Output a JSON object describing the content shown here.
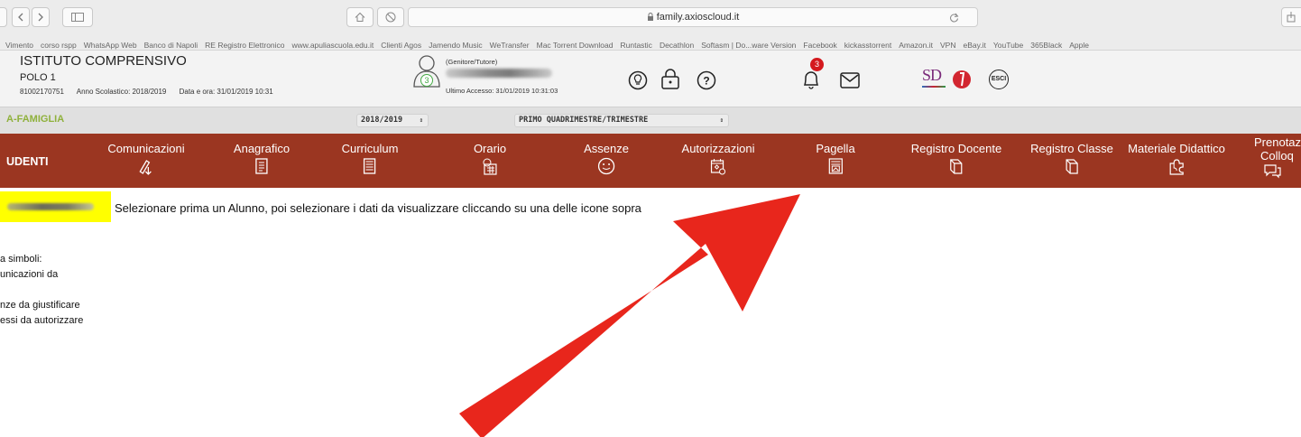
{
  "browser": {
    "url": "family.axioscloud.it"
  },
  "bookmarks": [
    "Vimento",
    "corso rspp",
    "WhatsApp Web",
    "Banco di Napoli",
    "RE Registro Elettronico",
    "www.apuliascuola.edu.it",
    "Clienti Agos",
    "Jamendo Music",
    "WeTransfer",
    "Mac Torrent Download",
    "Runtastic",
    "Decathlon",
    "Softasm | Do...ware Version",
    "Facebook",
    "kickasstorrent",
    "Amazon.it",
    "VPN",
    "eBay.it",
    "YouTube",
    "365Black",
    "Apple"
  ],
  "school": {
    "name": "ISTITUTO COMPRENSIVO",
    "polo": "POLO 1",
    "code": "81002170751",
    "year": "Anno Scolastico: 2018/2019",
    "datetime": "Data e ora: 31/01/2019 10:31"
  },
  "user": {
    "role": "(Genitore/Tutore)",
    "last_access": "Ultimo Accesso: 31/01/2019 10:31:03",
    "badge": "3"
  },
  "header": {
    "notifications_count": "3",
    "logo_text": "SD",
    "logout_label": "ESCI"
  },
  "filter": {
    "section": "A-FAMIGLIA",
    "year": "2018/2019",
    "period": "PRIMO QUADRIMESTRE/TRIMESTRE"
  },
  "nav": {
    "first": "UDENTI",
    "items": [
      "Comunicazioni",
      "Anagrafico",
      "Curriculum",
      "Orario",
      "Assenze",
      "Autorizzazioni",
      "Pagella",
      "Registro Docente",
      "Registro Classe",
      "Materiale Didattico"
    ],
    "last_line1": "Prenotaz",
    "last_line2": "Colloq"
  },
  "content": {
    "instruction": "Selezionare prima un Alunno, poi selezionare i dati da visualizzare cliccando su una delle icone sopra",
    "legend": [
      "a simboli:",
      "unicazioni da",
      "",
      "nze da giustificare",
      "essi da autorizzare"
    ]
  },
  "colors": {
    "nav_bg": "#9b3621",
    "section_label": "#8fb13c",
    "highlight": "#ffff00",
    "arrow": "#e8261c",
    "badge": "#d4191e"
  },
  "icons": [
    "back-icon",
    "forward-icon",
    "sidebar-icon",
    "home-icon",
    "block-icon",
    "lock-icon",
    "reload-icon",
    "share-icon",
    "lightbulb-icon",
    "padlock-icon",
    "help-icon",
    "bell-icon",
    "mail-icon",
    "logout-icon"
  ]
}
